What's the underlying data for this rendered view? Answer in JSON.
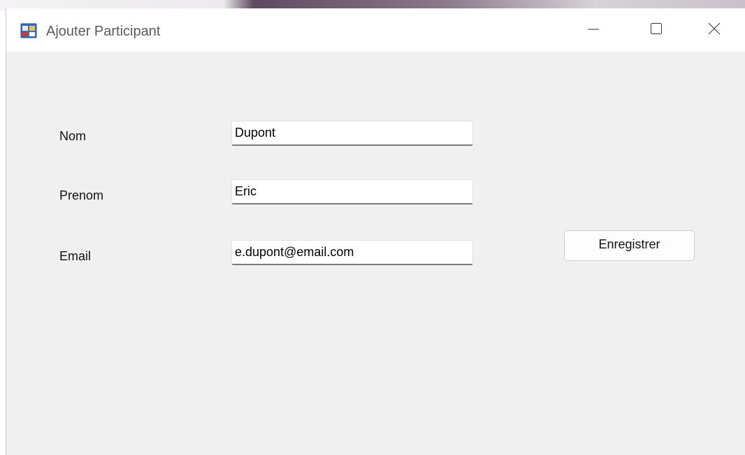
{
  "window": {
    "title": "Ajouter Participant",
    "icon": "windows-forms-app-icon",
    "controls": {
      "minimize_icon": "minimize-icon",
      "maximize_icon": "maximize-icon",
      "close_icon": "close-icon"
    }
  },
  "form": {
    "fields": [
      {
        "label": "Nom",
        "value": "Dupont"
      },
      {
        "label": "Prenom",
        "value": "Eric"
      },
      {
        "label": "Email",
        "value": "e.dupont@email.com"
      }
    ],
    "save_label": "Enregistrer"
  },
  "colors": {
    "window_background": "#f0f0f0",
    "titlebar_background": "#ffffff",
    "title_text": "#5a5a5a",
    "input_border_bottom": "#7a7a7a"
  }
}
